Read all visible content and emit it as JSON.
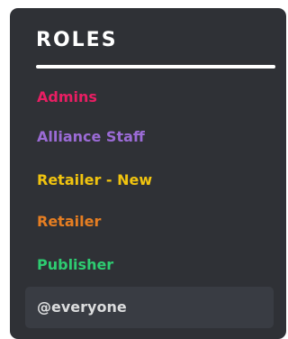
{
  "roles_panel": {
    "heading": "ROLES",
    "items": [
      {
        "label": "Admins",
        "color": "#e91e63"
      },
      {
        "label": "Alliance Staff",
        "color": "#9b6bd6"
      },
      {
        "label": "Retailer - New",
        "color": "#f1c40f"
      },
      {
        "label": "Retailer",
        "color": "#e67e22"
      },
      {
        "label": "Publisher",
        "color": "#2ecc71"
      },
      {
        "label": "@everyone",
        "color": "#dcddde",
        "selected": true
      }
    ]
  },
  "colors": {
    "panel_background": "#2f3136",
    "selected_row_background": "#393c43",
    "heading": "#ffffff"
  }
}
